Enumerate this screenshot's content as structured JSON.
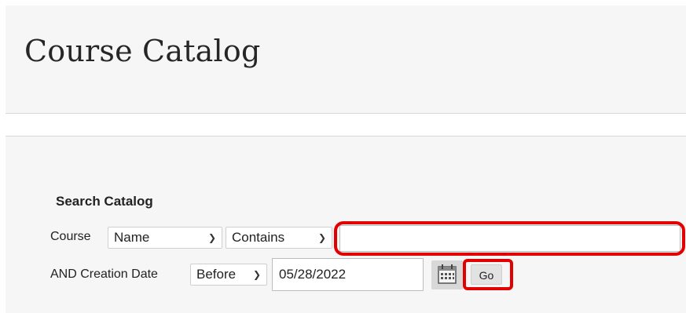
{
  "header": {
    "title": "Course Catalog"
  },
  "search": {
    "heading": "Search Catalog",
    "row1": {
      "label": "Course",
      "field_select": "Name",
      "operator_select": "Contains",
      "query_value": ""
    },
    "row2": {
      "label": "AND Creation Date",
      "operator_select": "Before",
      "date_value": "05/28/2022",
      "go_label": "Go"
    }
  },
  "icons": {
    "dropdown": "chevron-down-icon",
    "calendar": "calendar-icon"
  },
  "colors": {
    "highlight": "#e30000",
    "panel": "#f6f6f6"
  }
}
